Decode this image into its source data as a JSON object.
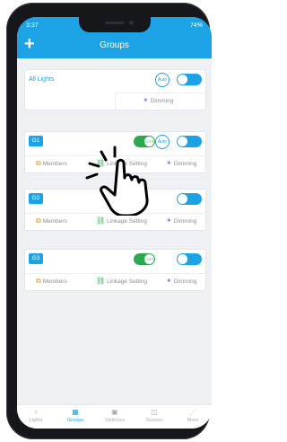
{
  "status": {
    "time": "3:37",
    "battery": "74%"
  },
  "header": {
    "title": "Groups",
    "add_icon": "plus-icon"
  },
  "all_lights": {
    "label": "All Lights",
    "auto": "Auto",
    "dimming": "Dimming"
  },
  "groups": [
    {
      "badge": "G1",
      "members": "Members",
      "linkage": "Linkage Setting",
      "dimming": "Dimming",
      "auto": "Auto",
      "toggle": "LOTS"
    },
    {
      "badge": "G2",
      "members": "Members",
      "linkage": "Linkage Setting",
      "dimming": "Dimming"
    },
    {
      "badge": "G3",
      "members": "Members",
      "linkage": "Linkage Setting",
      "dimming": "Dimming",
      "toggle": "LOTS"
    }
  ],
  "tabs": [
    {
      "label": "Lights",
      "icon": "bulb-icon"
    },
    {
      "label": "Groups",
      "icon": "groups-icon"
    },
    {
      "label": "Switches",
      "icon": "switch-icon"
    },
    {
      "label": "Scenes",
      "icon": "scene-icon"
    },
    {
      "label": "More",
      "icon": "share-icon"
    }
  ],
  "colors": {
    "accent": "#1ba3e6",
    "green": "#2ea84f",
    "orange": "#e89a28",
    "purple": "#9b7be0"
  }
}
